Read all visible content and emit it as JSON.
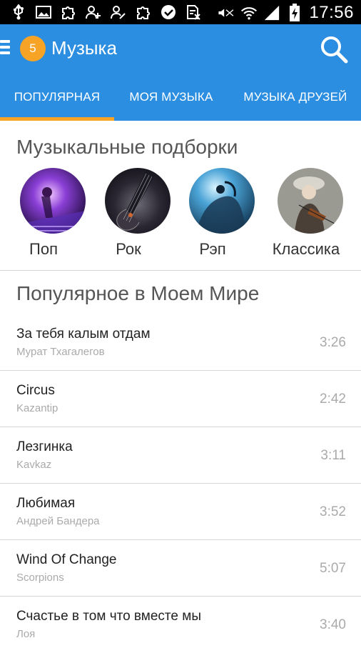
{
  "status_bar": {
    "time": "17:56",
    "icons": [
      "usb-icon",
      "image-icon",
      "puzzle-icon",
      "add-user-icon",
      "edit-user-icon",
      "puzzle-icon",
      "check-circle-icon",
      "sim-blocked-icon",
      "mute-icon",
      "wifi-icon",
      "signal-icon",
      "battery-charging-icon"
    ]
  },
  "app_bar": {
    "badge_count": "5",
    "title": "Музыка"
  },
  "tabs": [
    {
      "label": "ПОПУЛЯРНАЯ",
      "active": true
    },
    {
      "label": "МОЯ МУЗЫКА",
      "active": false
    },
    {
      "label": "МУЗЫКА ДРУЗЕЙ",
      "active": false
    }
  ],
  "collections": {
    "title": "Музыкальные подборки",
    "items": [
      {
        "label": "Поп"
      },
      {
        "label": "Рок"
      },
      {
        "label": "Рэп"
      },
      {
        "label": "Классика"
      }
    ]
  },
  "popular": {
    "title": "Популярное в Моем Мире",
    "tracks": [
      {
        "title": "За тебя калым отдам",
        "artist": "Мурат Тхагалегов",
        "duration": "3:26"
      },
      {
        "title": "Circus",
        "artist": "Kazantip",
        "duration": "2:42"
      },
      {
        "title": "Лезгинка",
        "artist": "Kavkaz",
        "duration": "3:11"
      },
      {
        "title": "Любимая",
        "artist": "Андрей Бандера",
        "duration": "3:52"
      },
      {
        "title": "Wind Of Change",
        "artist": "Scorpions",
        "duration": "5:07"
      },
      {
        "title": "Счастье в том что вместе мы",
        "artist": "Лоя",
        "duration": "3:40"
      }
    ]
  },
  "colors": {
    "primary": "#2b8ee0",
    "accent": "#f7a325"
  }
}
